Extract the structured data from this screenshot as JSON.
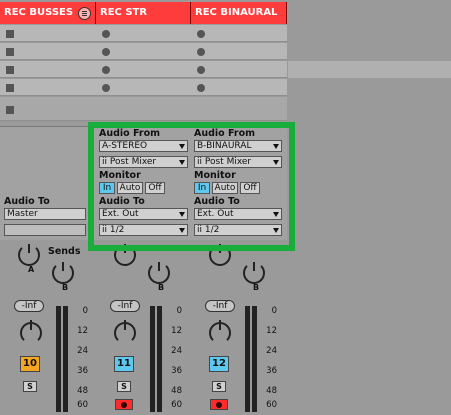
{
  "tracks": [
    {
      "name": "REC BUSSES",
      "audio_to_label": "Audio To",
      "audio_to": "Master",
      "sends_label": "Sends",
      "volume": "-Inf",
      "number": "10",
      "number_color": "#f5a623",
      "solo": "S"
    },
    {
      "name": "REC STR",
      "audio_from_label": "Audio From",
      "audio_from": "A-STEREO",
      "audio_from_tap": "Post Mixer",
      "monitor_label": "Monitor",
      "monitor": [
        "In",
        "Auto",
        "Off"
      ],
      "audio_to_label": "Audio To",
      "audio_to": "Ext. Out",
      "audio_to_channel": "1/2",
      "volume": "-Inf",
      "number": "11",
      "number_color": "#5ec8f0",
      "solo": "S"
    },
    {
      "name": "REC BINAURAL",
      "audio_from_label": "Audio From",
      "audio_from": "B-BINAURAL",
      "audio_from_tap": "Post Mixer",
      "monitor_label": "Monitor",
      "monitor": [
        "In",
        "Auto",
        "Off"
      ],
      "audio_to_label": "Audio To",
      "audio_to": "Ext. Out",
      "audio_to_channel": "1/2",
      "volume": "-Inf",
      "number": "12",
      "number_color": "#5ec8f0",
      "solo": "S"
    }
  ],
  "send_labels": [
    "A",
    "B"
  ],
  "meter_scale": [
    "0",
    "12",
    "24",
    "36",
    "48",
    "60"
  ],
  "highlight_color": "#19ad3c",
  "header_color": "#ff3c3c"
}
